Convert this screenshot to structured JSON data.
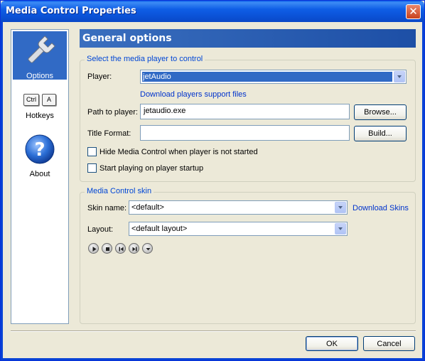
{
  "window": {
    "title": "Media Control Properties",
    "close_glyph": "✕"
  },
  "sidebar": {
    "items": [
      {
        "label": "Options",
        "icon": "wrench-icon",
        "active": true
      },
      {
        "label": "Hotkeys",
        "icon": "keyboard-keys-icon",
        "keys": [
          "Ctrl",
          "A"
        ]
      },
      {
        "label": "About",
        "icon": "help-icon"
      }
    ]
  },
  "header": {
    "title": "General options"
  },
  "player_group": {
    "legend": "Select the media player to control",
    "player_label": "Player:",
    "player_value": "jetAudio",
    "download_link": "Download players support files",
    "path_label": "Path to player:",
    "path_value": "jetaudio.exe",
    "browse_button": "Browse...",
    "title_format_label": "Title Format:",
    "title_format_value": "",
    "build_button": "Build...",
    "hide_checkbox_label": "Hide Media Control when player is not started",
    "hide_checked": false,
    "start_checkbox_label": "Start playing on player startup",
    "start_checked": false
  },
  "skin_group": {
    "legend": "Media Control skin",
    "skin_label": "Skin name:",
    "skin_value": "<default>",
    "download_skins_link": "Download Skins",
    "layout_label": "Layout:",
    "layout_value": "<default layout>",
    "preview_buttons": [
      "play-icon",
      "stop-icon",
      "previous-icon",
      "next-icon",
      "menu-icon"
    ]
  },
  "footer": {
    "ok_button": "OK",
    "cancel_button": "Cancel"
  },
  "colors": {
    "accent": "#316ac5",
    "link": "#0033cc",
    "legend": "#0046d5",
    "title_bar": "#0a5ce8"
  }
}
